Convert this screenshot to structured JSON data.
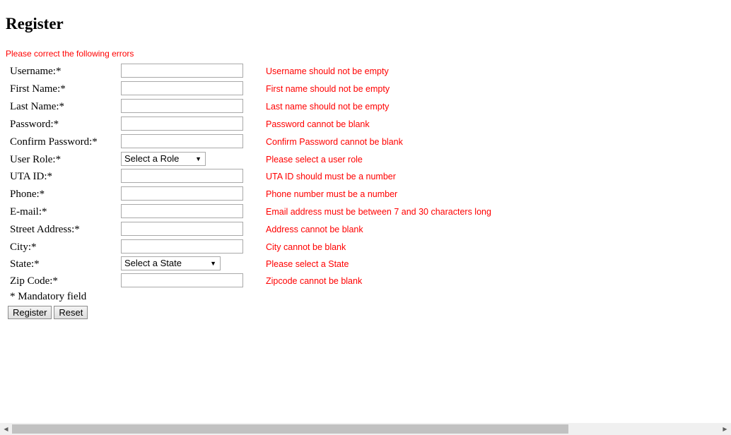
{
  "page": {
    "title": "Register",
    "error_header": "Please correct the following errors",
    "mandatory_note": "* Mandatory field"
  },
  "form": {
    "fields": [
      {
        "label": "Username:*",
        "type": "text",
        "value": "",
        "error": "Username should not be empty"
      },
      {
        "label": "First Name:*",
        "type": "text",
        "value": "",
        "error": "First name should not be empty"
      },
      {
        "label": "Last Name:*",
        "type": "text",
        "value": "",
        "error": "Last name should not be empty"
      },
      {
        "label": "Password:*",
        "type": "password",
        "value": "",
        "error": "Password cannot be blank"
      },
      {
        "label": "Confirm Password:*",
        "type": "password",
        "value": "",
        "error": "Confirm Password cannot be blank"
      },
      {
        "label": "User Role:*",
        "type": "select",
        "value": "Select a Role",
        "error": "Please select a user role"
      },
      {
        "label": "UTA ID:*",
        "type": "text",
        "value": "",
        "error": "UTA ID should must be a number"
      },
      {
        "label": "Phone:*",
        "type": "text",
        "value": "",
        "error": "Phone number must be a number"
      },
      {
        "label": "E-mail:*",
        "type": "text",
        "value": "",
        "error": "Email address must be between 7 and 30 characters long"
      },
      {
        "label": "Street Address:*",
        "type": "text",
        "value": "",
        "error": "Address cannot be blank"
      },
      {
        "label": "City:*",
        "type": "text",
        "value": "",
        "error": "City cannot be blank"
      },
      {
        "label": "State:*",
        "type": "select",
        "value": "Select a State",
        "error": "Please select a State"
      },
      {
        "label": "Zip Code:*",
        "type": "text",
        "value": "",
        "error": "Zipcode cannot be blank"
      }
    ],
    "buttons": {
      "register": "Register",
      "reset": "Reset"
    }
  },
  "colors": {
    "error": "#ff0000",
    "input_border": "#a9a9a9",
    "scroll_thumb": "#c1c1c1"
  },
  "icons": {
    "select_arrow": "dropdown-arrow-icon",
    "scroll_left": "scroll-left-arrow-icon",
    "scroll_right": "scroll-right-arrow-icon"
  }
}
